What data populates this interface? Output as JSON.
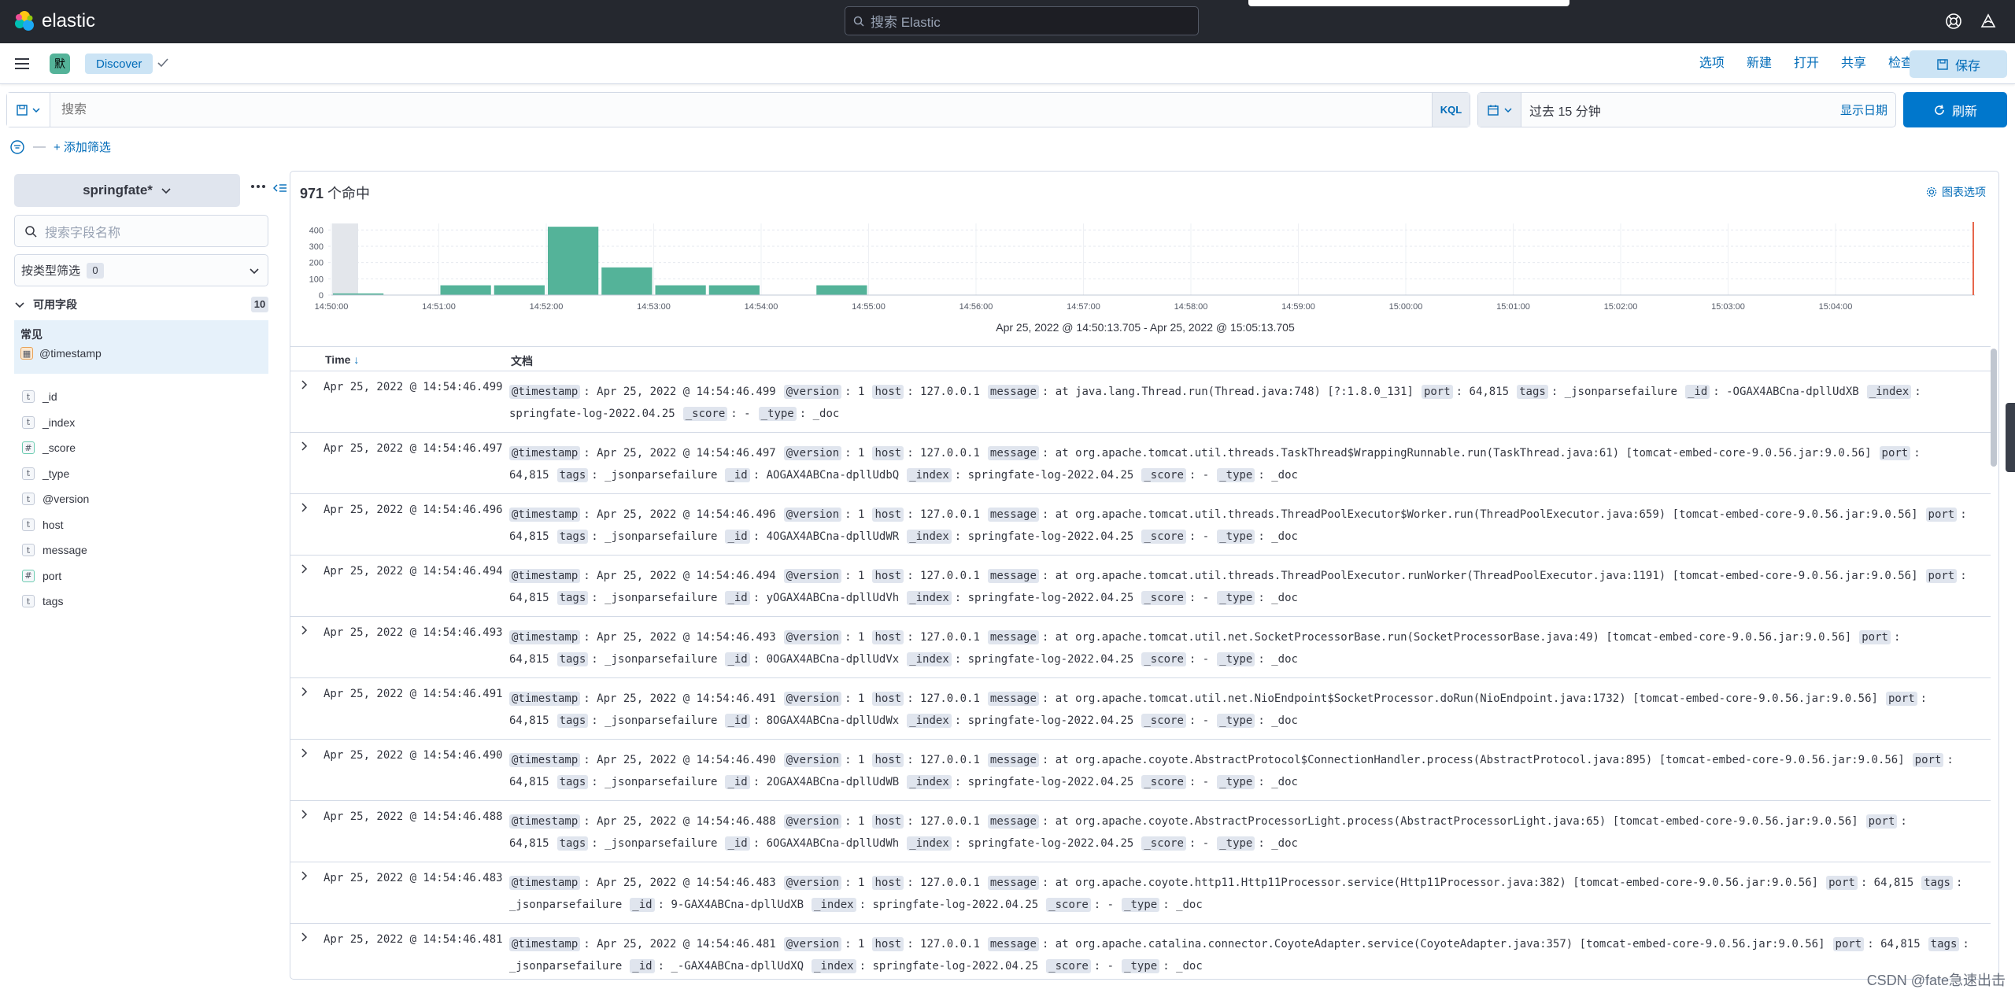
{
  "app": {
    "brand": "elastic",
    "search_placeholder": "搜索 Elastic"
  },
  "nav": {
    "space_badge": "默",
    "breadcrumb": "Discover",
    "links": [
      "选项",
      "新建",
      "打开",
      "共享",
      "检查"
    ],
    "save": "保存"
  },
  "query": {
    "placeholder": "搜索",
    "language": "KQL",
    "time_range": "过去 15 分钟",
    "show_dates": "显示日期",
    "refresh": "刷新",
    "add_filter": "+ 添加筛选"
  },
  "sidebar": {
    "index_pattern": "springfate*",
    "field_search_placeholder": "搜索字段名称",
    "filter_by_type": "按类型筛选",
    "filter_count": "0",
    "available_fields": "可用字段",
    "available_count": "10",
    "common_title": "常见",
    "common_fields": [
      {
        "name": "@timestamp",
        "type": "date"
      }
    ],
    "fields": [
      {
        "name": "_id",
        "type": "t"
      },
      {
        "name": "_index",
        "type": "t"
      },
      {
        "name": "_score",
        "type": "#"
      },
      {
        "name": "_type",
        "type": "t"
      },
      {
        "name": "@version",
        "type": "t"
      },
      {
        "name": "host",
        "type": "t"
      },
      {
        "name": "message",
        "type": "t"
      },
      {
        "name": "port",
        "type": "#"
      },
      {
        "name": "tags",
        "type": "t"
      }
    ]
  },
  "results": {
    "hit_count": "971",
    "hit_suffix": " 个命中",
    "chart_options": "图表选项",
    "range_caption": "Apr 25, 2022 @ 14:50:13.705 - Apr 25, 2022 @ 15:05:13.705",
    "col_time": "Time",
    "col_doc": "文档"
  },
  "chart_data": {
    "type": "bar",
    "x_ticks": [
      "14:50:00",
      "14:51:00",
      "14:52:00",
      "14:53:00",
      "14:54:00",
      "14:55:00",
      "14:56:00",
      "14:57:00",
      "14:58:00",
      "14:59:00",
      "15:00:00",
      "15:01:00",
      "15:02:00",
      "15:03:00",
      "15:04:00"
    ],
    "y_ticks": [
      "0",
      "100",
      "200",
      "300",
      "400"
    ],
    "ylim": [
      0,
      440
    ],
    "bins": [
      "14:50:00",
      "14:50:30",
      "14:51:00",
      "14:51:30",
      "14:52:00",
      "14:52:30",
      "14:53:00",
      "14:53:30",
      "14:54:00",
      "14:54:30",
      "14:55:00"
    ],
    "values": [
      10,
      0,
      60,
      60,
      420,
      170,
      60,
      60,
      0,
      60,
      0
    ],
    "bar_color": "#54b399"
  },
  "rows": [
    {
      "time": "Apr 25, 2022 @ 14:54:46.499",
      "fields": [
        [
          "@timestamp",
          "Apr 25, 2022 @ 14:54:46.499"
        ],
        [
          "@version",
          "1"
        ],
        [
          "host",
          "127.0.0.1"
        ],
        [
          "message",
          "at java.lang.Thread.run(Thread.java:748) [?:1.8.0_131]"
        ],
        [
          "port",
          "64,815"
        ],
        [
          "tags",
          "_jsonparsefailure"
        ],
        [
          "_id",
          "-OGAX4ABCna-dpllUdXB"
        ],
        [
          "_index",
          "springfate-log-2022.04.25"
        ],
        [
          "_score",
          "-"
        ],
        [
          "_type",
          "_doc"
        ]
      ]
    },
    {
      "time": "Apr 25, 2022 @ 14:54:46.497",
      "fields": [
        [
          "@timestamp",
          "Apr 25, 2022 @ 14:54:46.497"
        ],
        [
          "@version",
          "1"
        ],
        [
          "host",
          "127.0.0.1"
        ],
        [
          "message",
          "at org.apache.tomcat.util.threads.TaskThread$WrappingRunnable.run(TaskThread.java:61) [tomcat-embed-core-9.0.56.jar:9.0.56]"
        ],
        [
          "port",
          "64,815"
        ],
        [
          "tags",
          "_jsonparsefailure"
        ],
        [
          "_id",
          "AOGAX4ABCna-dpllUdbQ"
        ],
        [
          "_index",
          "springfate-log-2022.04.25"
        ],
        [
          "_score",
          "-"
        ],
        [
          "_type",
          "_doc"
        ]
      ]
    },
    {
      "time": "Apr 25, 2022 @ 14:54:46.496",
      "fields": [
        [
          "@timestamp",
          "Apr 25, 2022 @ 14:54:46.496"
        ],
        [
          "@version",
          "1"
        ],
        [
          "host",
          "127.0.0.1"
        ],
        [
          "message",
          "at org.apache.tomcat.util.threads.ThreadPoolExecutor$Worker.run(ThreadPoolExecutor.java:659) [tomcat-embed-core-9.0.56.jar:9.0.56]"
        ],
        [
          "port",
          "64,815"
        ],
        [
          "tags",
          "_jsonparsefailure"
        ],
        [
          "_id",
          "4OGAX4ABCna-dpllUdWR"
        ],
        [
          "_index",
          "springfate-log-2022.04.25"
        ],
        [
          "_score",
          "-"
        ],
        [
          "_type",
          "_doc"
        ]
      ]
    },
    {
      "time": "Apr 25, 2022 @ 14:54:46.494",
      "fields": [
        [
          "@timestamp",
          "Apr 25, 2022 @ 14:54:46.494"
        ],
        [
          "@version",
          "1"
        ],
        [
          "host",
          "127.0.0.1"
        ],
        [
          "message",
          "at org.apache.tomcat.util.threads.ThreadPoolExecutor.runWorker(ThreadPoolExecutor.java:1191) [tomcat-embed-core-9.0.56.jar:9.0.56]"
        ],
        [
          "port",
          "64,815"
        ],
        [
          "tags",
          "_jsonparsefailure"
        ],
        [
          "_id",
          "yOGAX4ABCna-dpllUdVh"
        ],
        [
          "_index",
          "springfate-log-2022.04.25"
        ],
        [
          "_score",
          "-"
        ],
        [
          "_type",
          "_doc"
        ]
      ]
    },
    {
      "time": "Apr 25, 2022 @ 14:54:46.493",
      "fields": [
        [
          "@timestamp",
          "Apr 25, 2022 @ 14:54:46.493"
        ],
        [
          "@version",
          "1"
        ],
        [
          "host",
          "127.0.0.1"
        ],
        [
          "message",
          "at org.apache.tomcat.util.net.SocketProcessorBase.run(SocketProcessorBase.java:49) [tomcat-embed-core-9.0.56.jar:9.0.56]"
        ],
        [
          "port",
          "64,815"
        ],
        [
          "tags",
          "_jsonparsefailure"
        ],
        [
          "_id",
          "0OGAX4ABCna-dpllUdVx"
        ],
        [
          "_index",
          "springfate-log-2022.04.25"
        ],
        [
          "_score",
          "-"
        ],
        [
          "_type",
          "_doc"
        ]
      ]
    },
    {
      "time": "Apr 25, 2022 @ 14:54:46.491",
      "fields": [
        [
          "@timestamp",
          "Apr 25, 2022 @ 14:54:46.491"
        ],
        [
          "@version",
          "1"
        ],
        [
          "host",
          "127.0.0.1"
        ],
        [
          "message",
          "at org.apache.tomcat.util.net.NioEndpoint$SocketProcessor.doRun(NioEndpoint.java:1732) [tomcat-embed-core-9.0.56.jar:9.0.56]"
        ],
        [
          "port",
          "64,815"
        ],
        [
          "tags",
          "_jsonparsefailure"
        ],
        [
          "_id",
          "8OGAX4ABCna-dpllUdWx"
        ],
        [
          "_index",
          "springfate-log-2022.04.25"
        ],
        [
          "_score",
          "-"
        ],
        [
          "_type",
          "_doc"
        ]
      ]
    },
    {
      "time": "Apr 25, 2022 @ 14:54:46.490",
      "fields": [
        [
          "@timestamp",
          "Apr 25, 2022 @ 14:54:46.490"
        ],
        [
          "@version",
          "1"
        ],
        [
          "host",
          "127.0.0.1"
        ],
        [
          "message",
          "at org.apache.coyote.AbstractProtocol$ConnectionHandler.process(AbstractProtocol.java:895) [tomcat-embed-core-9.0.56.jar:9.0.56]"
        ],
        [
          "port",
          "64,815"
        ],
        [
          "tags",
          "_jsonparsefailure"
        ],
        [
          "_id",
          "2OGAX4ABCna-dpllUdWB"
        ],
        [
          "_index",
          "springfate-log-2022.04.25"
        ],
        [
          "_score",
          "-"
        ],
        [
          "_type",
          "_doc"
        ]
      ]
    },
    {
      "time": "Apr 25, 2022 @ 14:54:46.488",
      "fields": [
        [
          "@timestamp",
          "Apr 25, 2022 @ 14:54:46.488"
        ],
        [
          "@version",
          "1"
        ],
        [
          "host",
          "127.0.0.1"
        ],
        [
          "message",
          "at org.apache.coyote.AbstractProcessorLight.process(AbstractProcessorLight.java:65) [tomcat-embed-core-9.0.56.jar:9.0.56]"
        ],
        [
          "port",
          "64,815"
        ],
        [
          "tags",
          "_jsonparsefailure"
        ],
        [
          "_id",
          "6OGAX4ABCna-dpllUdWh"
        ],
        [
          "_index",
          "springfate-log-2022.04.25"
        ],
        [
          "_score",
          "-"
        ],
        [
          "_type",
          "_doc"
        ]
      ]
    },
    {
      "time": "Apr 25, 2022 @ 14:54:46.483",
      "fields": [
        [
          "@timestamp",
          "Apr 25, 2022 @ 14:54:46.483"
        ],
        [
          "@version",
          "1"
        ],
        [
          "host",
          "127.0.0.1"
        ],
        [
          "message",
          "at org.apache.coyote.http11.Http11Processor.service(Http11Processor.java:382) [tomcat-embed-core-9.0.56.jar:9.0.56]"
        ],
        [
          "port",
          "64,815"
        ],
        [
          "tags",
          "_jsonparsefailure"
        ],
        [
          "_id",
          "9-GAX4ABCna-dpllUdXB"
        ],
        [
          "_index",
          "springfate-log-2022.04.25"
        ],
        [
          "_score",
          "-"
        ],
        [
          "_type",
          "_doc"
        ]
      ]
    },
    {
      "time": "Apr 25, 2022 @ 14:54:46.481",
      "fields": [
        [
          "@timestamp",
          "Apr 25, 2022 @ 14:54:46.481"
        ],
        [
          "@version",
          "1"
        ],
        [
          "host",
          "127.0.0.1"
        ],
        [
          "message",
          "at org.apache.catalina.connector.CoyoteAdapter.service(CoyoteAdapter.java:357) [tomcat-embed-core-9.0.56.jar:9.0.56]"
        ],
        [
          "port",
          "64,815"
        ],
        [
          "tags",
          "_jsonparsefailure"
        ],
        [
          "_id",
          "_-GAX4ABCna-dpllUdXQ"
        ],
        [
          "_index",
          "springfate-log-2022.04.25"
        ],
        [
          "_score",
          "-"
        ],
        [
          "_type",
          "_doc"
        ]
      ]
    }
  ],
  "watermark": "CSDN @fate急速出击"
}
